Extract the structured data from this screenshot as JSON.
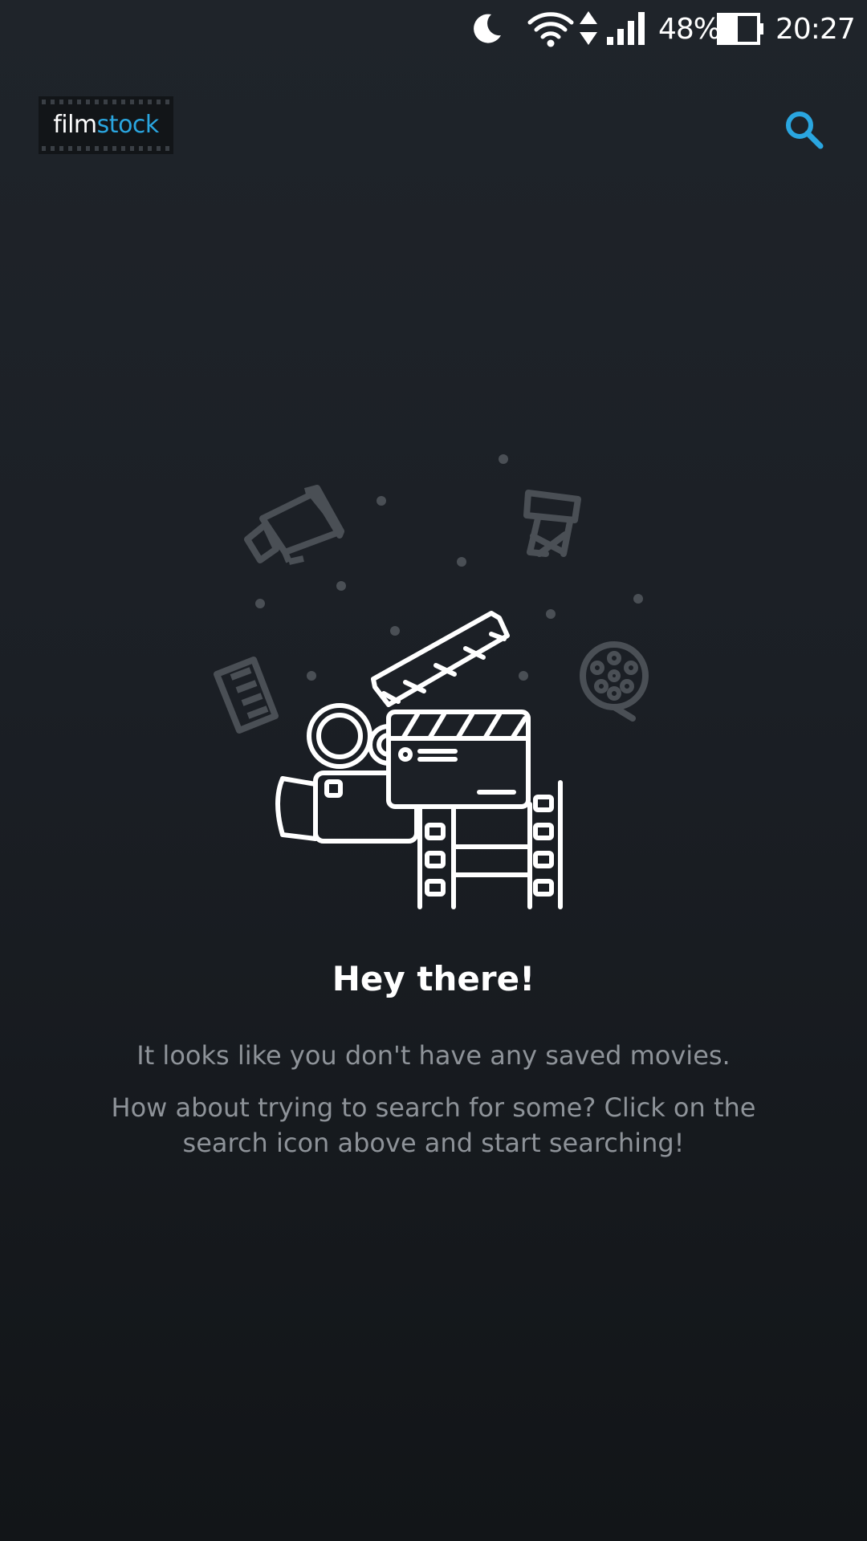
{
  "status_bar": {
    "battery_percent": "48%",
    "time": "20:27",
    "icons": [
      "moon-icon",
      "wifi-icon",
      "data-arrows-icon",
      "signal-icon",
      "battery-icon"
    ],
    "battery_level": 0.48
  },
  "app_bar": {
    "logo_part1": "film",
    "logo_part2": "stock",
    "search_icon": "search-icon"
  },
  "empty_state": {
    "title": "Hey there!",
    "message_1": "It looks like you don't have any saved movies.",
    "message_2": "How about trying to search for some? Click on the search icon above and start searching!"
  },
  "colors": {
    "accent": "#2aa6e0",
    "background_top": "#1f242a",
    "background_bottom": "#121518",
    "muted_text": "#8e9399",
    "faded_icon": "#4a4f55"
  }
}
